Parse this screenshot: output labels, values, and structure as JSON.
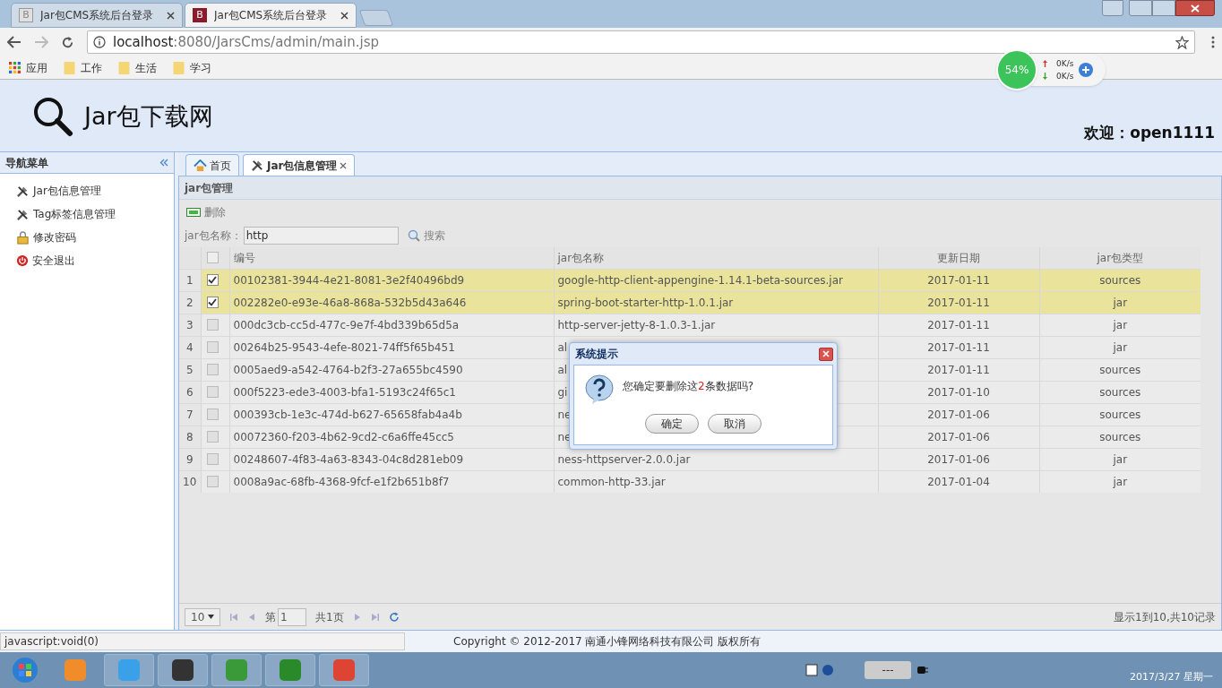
{
  "browser": {
    "tabs": [
      {
        "title": "Jar包CMS系统后台登录",
        "selected": false,
        "favicon": "B"
      },
      {
        "title": "Jar包CMS系统后台登录",
        "selected": true,
        "favicon": "B"
      }
    ],
    "address": {
      "host": "localhost",
      "path": ":8080/JarsCms/admin/main.jsp"
    },
    "bookmarks": [
      {
        "label": "应用",
        "kind": "apps"
      },
      {
        "label": "工作",
        "kind": "folder"
      },
      {
        "label": "生活",
        "kind": "folder"
      },
      {
        "label": "学习",
        "kind": "folder"
      }
    ]
  },
  "net_widget": {
    "percent": "54%",
    "up": "0K/s",
    "down": "0K/s"
  },
  "header": {
    "logo_text": "Jar包下载网",
    "welcome": "欢迎：open1111"
  },
  "nav": {
    "title": "导航菜单",
    "items": [
      {
        "label": "Jar包信息管理",
        "kind": "tools"
      },
      {
        "label": "Tag标签信息管理",
        "kind": "tools"
      },
      {
        "label": "修改密码",
        "kind": "lock"
      },
      {
        "label": "安全退出",
        "kind": "power"
      }
    ]
  },
  "tabs": [
    {
      "label": "首页",
      "kind": "home",
      "selected": false,
      "closable": false
    },
    {
      "label": "Jar包信息管理",
      "kind": "tools",
      "selected": true,
      "closable": true
    }
  ],
  "panel": {
    "title": "jar包管理",
    "delete_label": "删除",
    "search_label": "jar包名称：",
    "search_value": "http",
    "search_button": "搜索"
  },
  "table": {
    "select_all_checked": false,
    "columns": [
      "编号",
      "jar包名称",
      "更新日期",
      "jar包类型"
    ],
    "rows": [
      {
        "index": "1",
        "selected": true,
        "id": "00102381-3944-4e21-8081-3e2f40496bd9",
        "name": "google-http-client-appengine-1.14.1-beta-sources.jar",
        "date": "2017-01-11",
        "type": "sources"
      },
      {
        "index": "2",
        "selected": true,
        "id": "002282e0-e93e-46a8-868a-532b5d43a646",
        "name": "spring-boot-starter-http-1.0.1.jar",
        "date": "2017-01-11",
        "type": "jar"
      },
      {
        "index": "3",
        "selected": false,
        "id": "000dc3cb-cc5d-477c-9e7f-4bd339b65d5a",
        "name": "http-server-jetty-8-1.0.3-1.jar",
        "date": "2017-01-11",
        "type": "jar"
      },
      {
        "index": "4",
        "selected": false,
        "id": "00264b25-9543-4efe-8021-74ff5f65b451",
        "name": "al",
        "date": "2017-01-11",
        "type": "jar"
      },
      {
        "index": "5",
        "selected": false,
        "id": "0005aed9-a542-4764-b2f3-27a655bc4590",
        "name": "al",
        "date": "2017-01-11",
        "type": "sources"
      },
      {
        "index": "6",
        "selected": false,
        "id": "000f5223-ede3-4003-bfa1-5193c24f65c1",
        "name": "gi",
        "date": "2017-01-10",
        "type": "sources"
      },
      {
        "index": "7",
        "selected": false,
        "id": "000393cb-1e3c-474d-b627-65658fab4a4b",
        "name": "ne",
        "date": "2017-01-06",
        "type": "sources"
      },
      {
        "index": "8",
        "selected": false,
        "id": "00072360-f203-4b62-9cd2-c6a6ffe45cc5",
        "name": "ne",
        "date": "2017-01-06",
        "type": "sources"
      },
      {
        "index": "9",
        "selected": false,
        "id": "00248607-4f83-4a63-8343-04c8d281eb09",
        "name": "ness-httpserver-2.0.0.jar",
        "date": "2017-01-06",
        "type": "jar"
      },
      {
        "index": "10",
        "selected": false,
        "id": "0008a9ac-68fb-4368-9fcf-e1f2b651b8f7",
        "name": "common-http-33.jar",
        "date": "2017-01-04",
        "type": "jar"
      }
    ]
  },
  "pager": {
    "page_size": "10",
    "page_prefix": "第",
    "page": "1",
    "page_suffix": "共1页",
    "summary": "显示1到10,共10记录"
  },
  "dialog": {
    "title": "系统提示",
    "text_before": "您确定要删除这",
    "count": "2",
    "text_after": "条数据吗?",
    "buttons": [
      "确定",
      "取消"
    ]
  },
  "status_url": "javascript:void(0)",
  "footer": "Copyright © 2012-2017 南通小锋网络科技有限公司 版权所有",
  "taskbar": {
    "date": "2017/3/27 星期一",
    "battery": "---"
  }
}
